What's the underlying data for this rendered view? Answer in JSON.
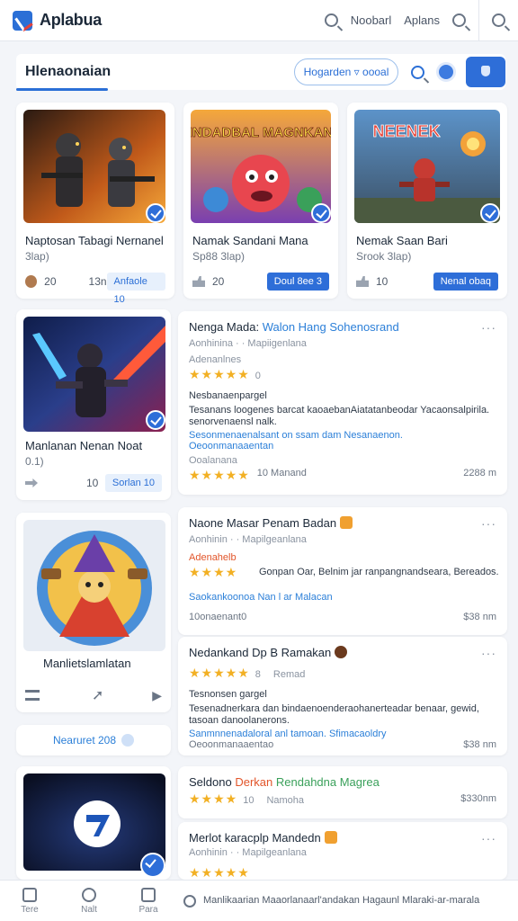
{
  "app": {
    "title": "Aplabua"
  },
  "header": {
    "link1": "Noobarl",
    "link2": "Aplans"
  },
  "search": {
    "label": "Hlenaonaian",
    "placeholder": "Hogarden "
  },
  "games": [
    {
      "title": "Naptosan Tabagi Nernanel",
      "sub": "3lap)",
      "count": "20",
      "meta": "13n",
      "button": "Anfaole 10"
    },
    {
      "title": "Namak Sandani Mana",
      "sub": "Sp88 3lap)",
      "count": "20",
      "meta": "",
      "button": "Doul 8ee 3"
    },
    {
      "title": "Nemak Saan Bari",
      "sub": "Srook 3lap)",
      "count": "10",
      "meta": "",
      "button": "Nenal obaq"
    },
    {
      "title": "Manlanan Nenan Noat",
      "sub": "0.1)",
      "count": "",
      "meta": "10",
      "button": "Sorlan 10"
    },
    {
      "title": "Manlietslamlatan",
      "sub": "",
      "count": "",
      "meta": "",
      "button": ""
    }
  ],
  "thumb_art": {
    "t2": "INDADBAL MAGNKAN",
    "t3": "NEENEK"
  },
  "reviews": [
    {
      "title": "Nenga Mada",
      "title_link": "Walon Hang Sohenosrand",
      "sub": "Aonhinina · · Mapiigenlana",
      "section": "Adenanlnes",
      "stars": "★★★★★",
      "count": "0",
      "label": "Nesbanaenpargel",
      "body": "Tesanans loogenes barcat kaoaebanAiatatanbeodar Yacaonsalpirila. senorvenaensl nalk.",
      "link1": "Sesonmenaenalsant on ssam dam Nesanaenon.",
      "link2": "Oeoonmanaaentan",
      "foot_label": "Ooalanana",
      "foot_stars": "★★★★★",
      "foot_count": "10 Manand",
      "price": "2288 m"
    },
    {
      "title": "Naone Masar Penam Badan",
      "sub": "Aonhinin · · Mapilgeanlana",
      "section": "Adenahelb",
      "stars": "★★★★",
      "body": "Gonpan Oar, Belnim jar ranpangnandseara, Bereados.",
      "link1": "Saokankoonoa Nan l ar Malacan",
      "foot_label": "10onaenant0",
      "price": "$38 nm"
    },
    {
      "title": "Nedankand Dp B Ramakan",
      "stars": "★★★★★",
      "count": "8",
      "extra": "Remad",
      "label": "Tesnonsen gargel",
      "body": "Tesenadnerkara dan bindaenoenderaohanerteadar benaar, gewid, tasoan danoolanerons.",
      "link1": "Sanmnnenadaloral anl tamoan. Sfimacaoldry",
      "link2": "Oeoonmanaaentao",
      "price": "$38 nm"
    },
    {
      "title": "Seldono",
      "title_red": "Derkan",
      "title_green": "Rendahdna Magrea",
      "stars": "★★★★",
      "count": "10",
      "extra": "Namoha",
      "price": "$330nm"
    },
    {
      "title": "Merlot karacplp Mandedn",
      "sub": "Aonhinin · · Mapilgeanlana",
      "stars": "★★★★★"
    }
  ],
  "promo": {
    "label": "Nearuret 208"
  },
  "bottom": {
    "tabs": [
      "Tere",
      "Nalt",
      "Para"
    ],
    "message": "Manlikaarian Maaorlanaarl'andakan Hagaunl Mlaraki-ar-marala"
  }
}
